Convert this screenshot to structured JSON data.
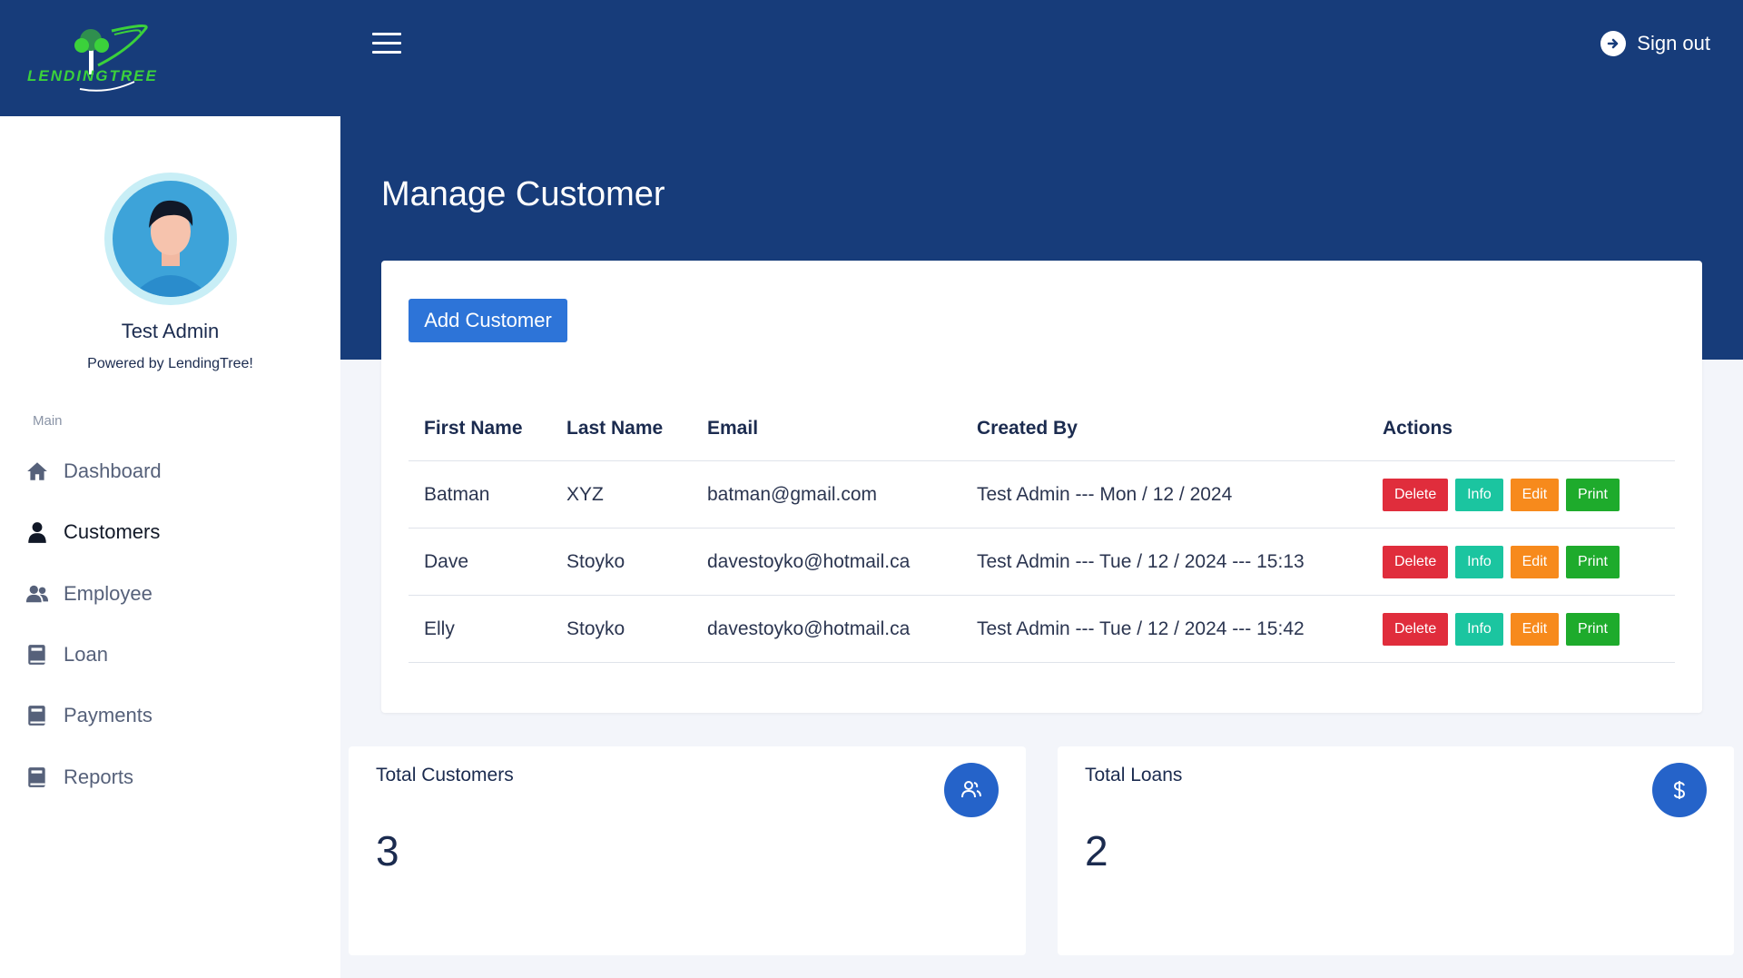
{
  "brand": {
    "name": "LENDINGTREE",
    "logo_icon": "tree-logo-icon"
  },
  "header": {
    "signout_label": "Sign out",
    "signout_icon": "arrow-right-circle-icon",
    "menu_icon": "hamburger-icon"
  },
  "sidebar": {
    "user_name": "Test Admin",
    "powered_by": "Powered by LendingTree!",
    "section_label": "Main",
    "items": [
      {
        "label": "Dashboard",
        "icon": "home-icon",
        "active": false
      },
      {
        "label": "Customers",
        "icon": "user-icon",
        "active": true
      },
      {
        "label": "Employee",
        "icon": "users-icon",
        "active": false
      },
      {
        "label": "Loan",
        "icon": "book-icon",
        "active": false
      },
      {
        "label": "Payments",
        "icon": "book-icon",
        "active": false
      },
      {
        "label": "Reports",
        "icon": "book-icon",
        "active": false
      }
    ]
  },
  "page": {
    "title": "Manage Customer"
  },
  "customers": {
    "add_button": "Add Customer",
    "columns": [
      "First Name",
      "Last Name",
      "Email",
      "Created By",
      "Actions"
    ],
    "actions": [
      "Delete",
      "Info",
      "Edit",
      "Print"
    ],
    "rows": [
      {
        "first": "Batman",
        "last": "XYZ",
        "email": "batman@gmail.com",
        "created": "Test Admin --- Mon / 12 / 2024"
      },
      {
        "first": "Dave",
        "last": "Stoyko",
        "email": "davestoyko@hotmail.ca",
        "created": "Test Admin --- Tue / 12 / 2024 --- 15:13"
      },
      {
        "first": "Elly",
        "last": "Stoyko",
        "email": "davestoyko@hotmail.ca",
        "created": "Test Admin --- Tue / 12 / 2024 --- 15:42"
      }
    ]
  },
  "stats": [
    {
      "label": "Total Customers",
      "value": "3",
      "icon": "users-icon"
    },
    {
      "label": "Total Loans",
      "value": "2",
      "icon": "dollar-icon"
    }
  ],
  "colors": {
    "navy": "#173c7a",
    "primary": "#2d74d8",
    "delete": "#e02d3c",
    "info": "#1bc5a0",
    "edit": "#f78a1c",
    "print": "#1eab2c"
  }
}
